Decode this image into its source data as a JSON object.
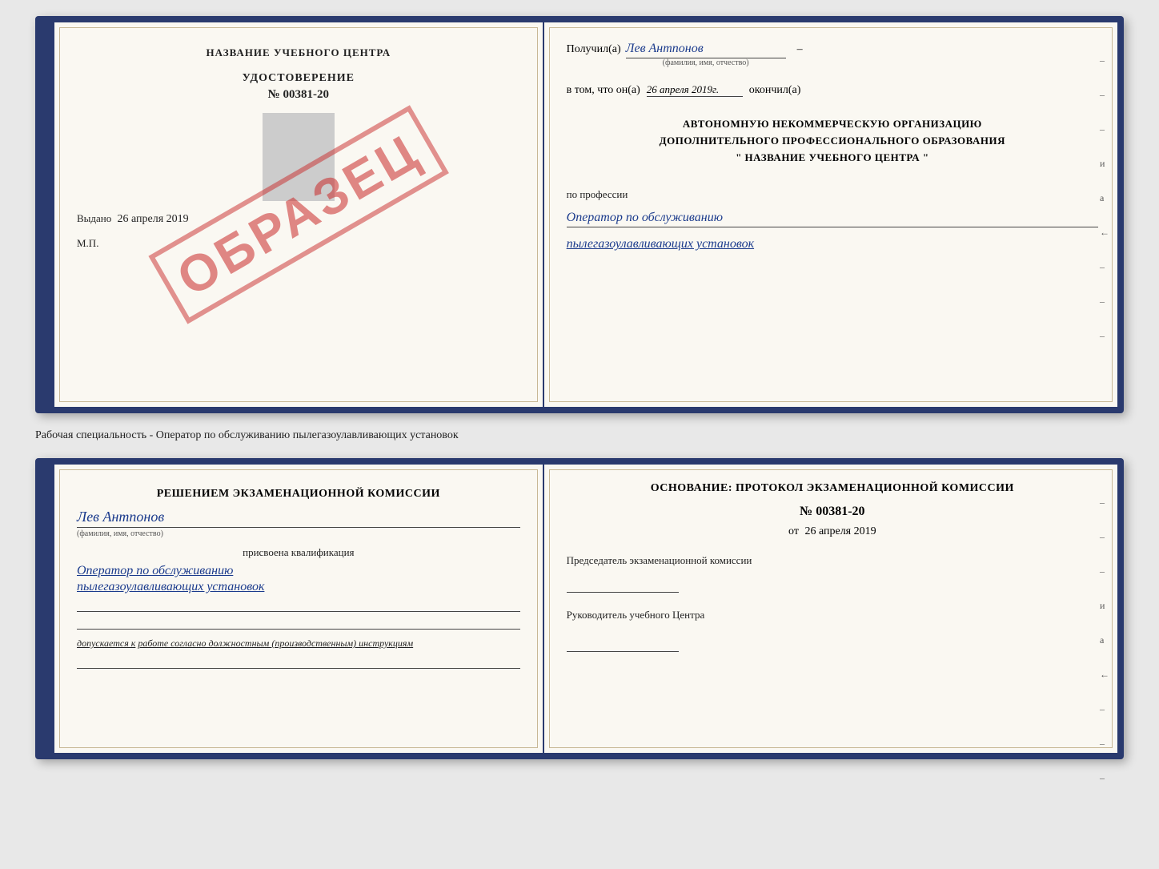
{
  "top_book": {
    "left_page": {
      "title": "НАЗВАНИЕ УЧЕБНОГО ЦЕНТРА",
      "stamp_text": "ОБРАЗЕЦ",
      "cert_label": "УДОСТОВЕРЕНИЕ",
      "cert_number": "№ 00381-20",
      "vydano_label": "Выдано",
      "vydano_date": "26 апреля 2019",
      "mp_label": "М.П."
    },
    "right_page": {
      "poluchil_label": "Получил(а)",
      "recipient_name": "Лев Антпонов",
      "fio_caption": "(фамилия, имя, отчество)",
      "dash": "–",
      "date_label": "в том, что он(а)",
      "date_value": "26 апреля 2019г.",
      "okonchil_label": "окончил(а)",
      "org_line1": "АВТОНОМНУЮ НЕКОММЕРЧЕСКУЮ ОРГАНИЗАЦИЮ",
      "org_line2": "ДОПОЛНИТЕЛЬНОГО ПРОФЕССИОНАЛЬНОГО ОБРАЗОВАНИЯ",
      "org_name": "\"   НАЗВАНИЕ УЧЕБНОГО ЦЕНТРА   \"",
      "profession_label": "по профессии",
      "profession_line1": "Оператор по обслуживанию",
      "profession_line2": "пылегазоулавливающих установок",
      "margin_marks": [
        "–",
        "–",
        "–",
        "и",
        "а",
        "←",
        "–",
        "–",
        "–"
      ]
    }
  },
  "separator": {
    "text": "Рабочая специальность - Оператор по обслуживанию пылегазоулавливающих установок"
  },
  "bottom_book": {
    "left_page": {
      "resolution_text": "Решением экзаменационной комиссии",
      "person_name": "Лев Антпонов",
      "fio_caption": "(фамилия, имя, отчество)",
      "assigned_label": "присвоена квалификация",
      "qual_line1": "Оператор по обслуживанию",
      "qual_line2": "пылегазоулавливающих установок",
      "допускается_label": "допускается к",
      "допускается_value": "работе согласно должностным (производственным) инструкциям"
    },
    "right_page": {
      "osnovaniye_label": "Основание: протокол экзаменационной комиссии",
      "protocol_number": "№  00381-20",
      "ot_label": "от",
      "ot_date": "26 апреля 2019",
      "chairman_label": "Председатель экзаменационной комиссии",
      "rukovoditel_label": "Руководитель учебного Центра",
      "margin_marks": [
        "–",
        "–",
        "–",
        "и",
        "а",
        "←",
        "–",
        "–",
        "–"
      ]
    }
  }
}
